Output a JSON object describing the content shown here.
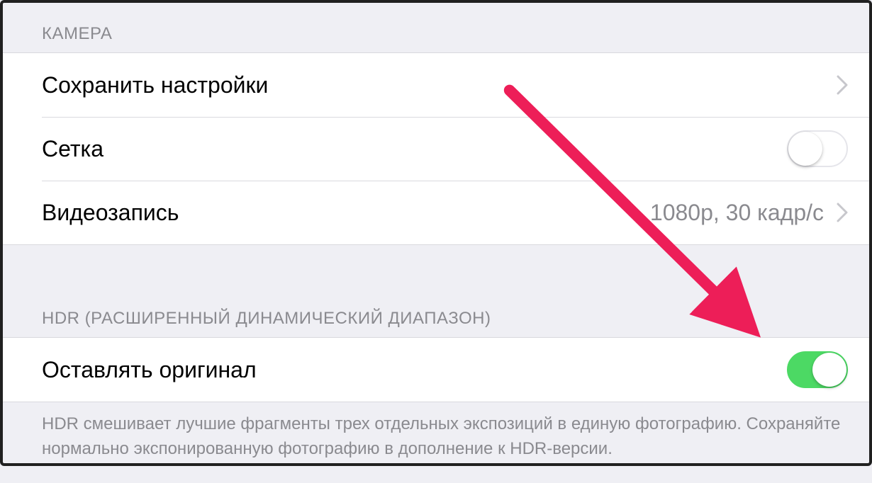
{
  "sections": {
    "camera": {
      "header": "КАМЕРА",
      "rows": {
        "preserve_settings": {
          "label": "Сохранить настройки"
        },
        "grid": {
          "label": "Сетка",
          "toggle": false
        },
        "record_video": {
          "label": "Видеозапись",
          "detail": "1080p, 30 кадр/с"
        }
      }
    },
    "hdr": {
      "header": "HDR (РАСШИРЕННЫЙ ДИНАМИЧЕСКИЙ ДИАПАЗОН)",
      "rows": {
        "keep_normal": {
          "label": "Оставлять оригинал",
          "toggle": true
        }
      },
      "footer": "HDR смешивает лучшие фрагменты трех отдельных экспозиций в единую фотографию. Сохраняйте нормально экспонированную фотографию в дополнение к HDR-версии."
    }
  },
  "annotation": {
    "arrow_color": "#ed1e58"
  }
}
